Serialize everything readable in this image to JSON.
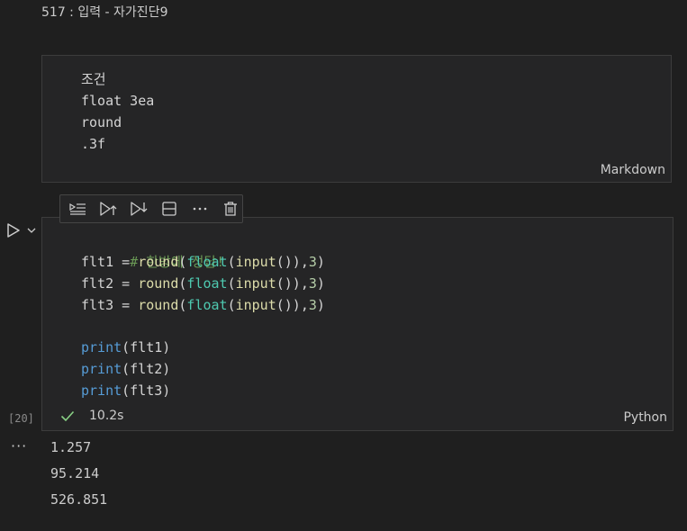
{
  "header": {
    "title": "517 : 입력 - 자가진단9"
  },
  "markdown_cell": {
    "lines": [
      "조건",
      "float 3ea",
      "round",
      ".3f"
    ],
    "language": "Markdown"
  },
  "toolbar": {
    "icons": [
      "execute-above-icon",
      "run-above-icon",
      "run-below-icon",
      "split-cell-icon",
      "more-icon",
      "delete-icon"
    ]
  },
  "code_cell": {
    "execution_count": "[20]",
    "code": {
      "comment": "# 한방에 정답!",
      "assign_lines": [
        {
          "var": "flt1",
          "eq": " = ",
          "round": "round",
          "p1": "(",
          "float": "float",
          "p2": "(",
          "input": "input",
          "p3": "()),",
          "num": "3",
          "p4": ")"
        },
        {
          "var": "flt2",
          "eq": " = ",
          "round": "round",
          "p1": "(",
          "float": "float",
          "p2": "(",
          "input": "input",
          "p3": "()),",
          "num": "3",
          "p4": ")"
        },
        {
          "var": "flt3",
          "eq": " = ",
          "round": "round",
          "p1": "(",
          "float": "float",
          "p2": "(",
          "input": "input",
          "p3": "()),",
          "num": "3",
          "p4": ")"
        }
      ],
      "print_lines": [
        {
          "fn": "print",
          "arg": "(flt1)"
        },
        {
          "fn": "print",
          "arg": "(flt2)"
        },
        {
          "fn": "print",
          "arg": "(flt3)"
        }
      ]
    },
    "status": "10.2s",
    "language": "Python"
  },
  "output": {
    "menu": "···",
    "lines": [
      "1.257",
      "95.214",
      "526.851"
    ]
  },
  "colors": {
    "background": "#1f1f1f",
    "cell": "#252526",
    "comment": "#6a9955",
    "function": "#dcdcaa",
    "type": "#4ec9b0",
    "builtin": "#569cd6",
    "number": "#b5cea8",
    "success": "#89d185"
  }
}
